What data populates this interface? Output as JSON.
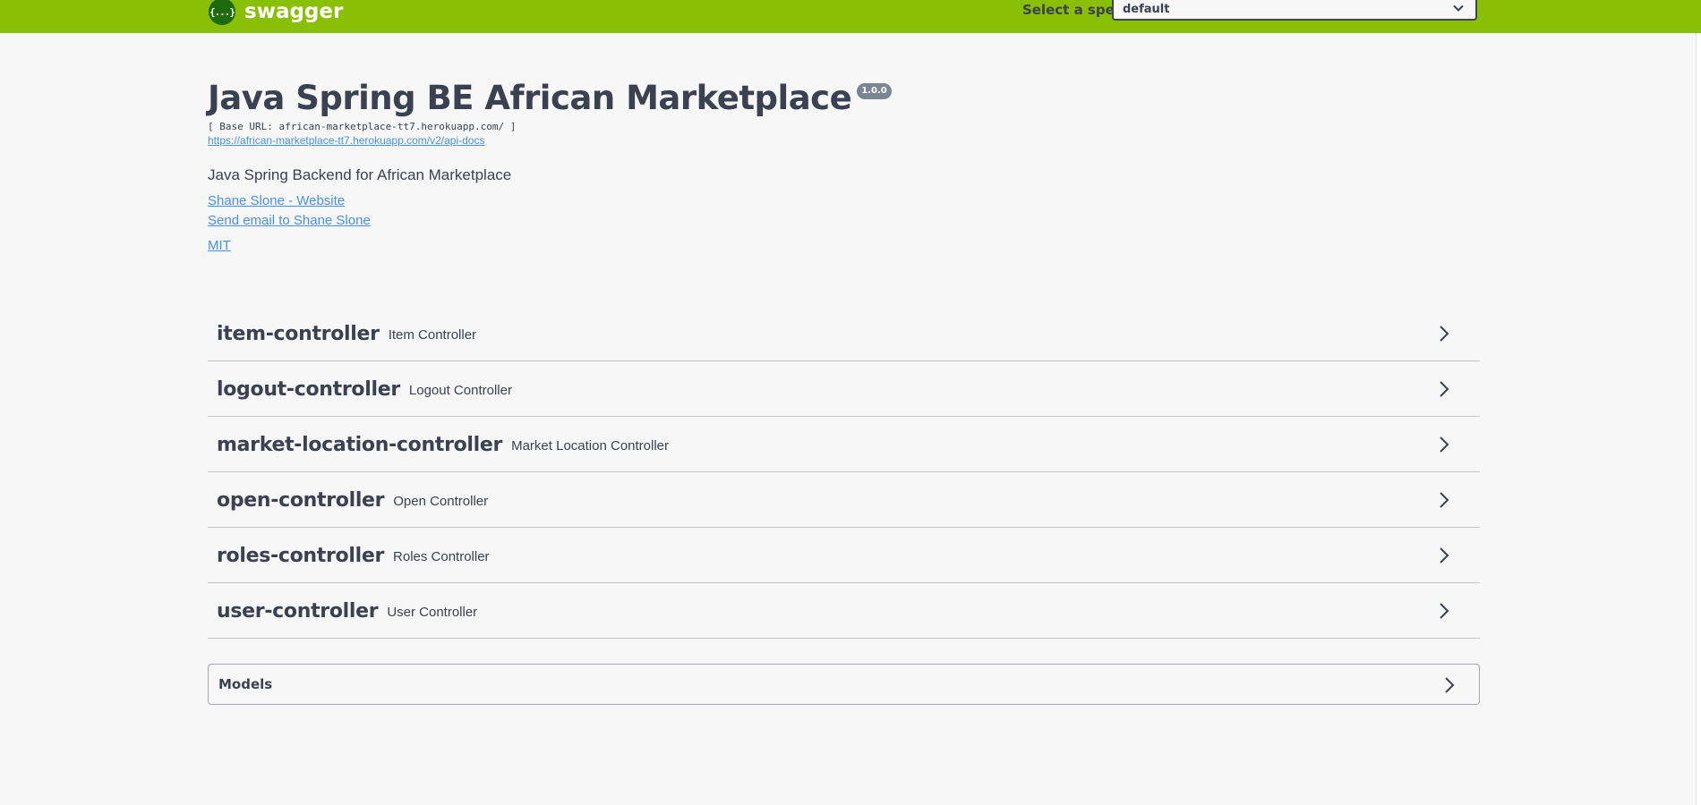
{
  "topbar": {
    "brand": "swagger",
    "logo_glyph": "{...}",
    "spec_label": "Select a spec",
    "spec_selected": "default"
  },
  "info": {
    "title": "Java Spring BE African Marketplace",
    "version": "1.0.0",
    "base_url": "[ Base URL: african-marketplace-tt7.herokuapp.com/ ]",
    "spec_url": "https://african-marketplace-tt7.herokuapp.com/v2/api-docs",
    "description": "Java Spring Backend for African Marketplace",
    "contact_website": "Shane Slone - Website",
    "contact_email": "Send email to Shane Slone",
    "license": "MIT"
  },
  "tags": [
    {
      "name": "item-controller",
      "description": "Item Controller"
    },
    {
      "name": "logout-controller",
      "description": "Logout Controller"
    },
    {
      "name": "market-location-controller",
      "description": "Market Location Controller"
    },
    {
      "name": "open-controller",
      "description": "Open Controller"
    },
    {
      "name": "roles-controller",
      "description": "Roles Controller"
    },
    {
      "name": "user-controller",
      "description": "User Controller"
    }
  ],
  "models": {
    "title": "Models"
  },
  "icons": {
    "expand": "chevron-right-icon",
    "dropdown": "chevron-down-icon",
    "logo": "swagger-logo-icon"
  },
  "colors": {
    "topbar": "#89bf04",
    "link": "#4990e2",
    "text": "#3b4151",
    "version_badge": "#7d8492"
  }
}
